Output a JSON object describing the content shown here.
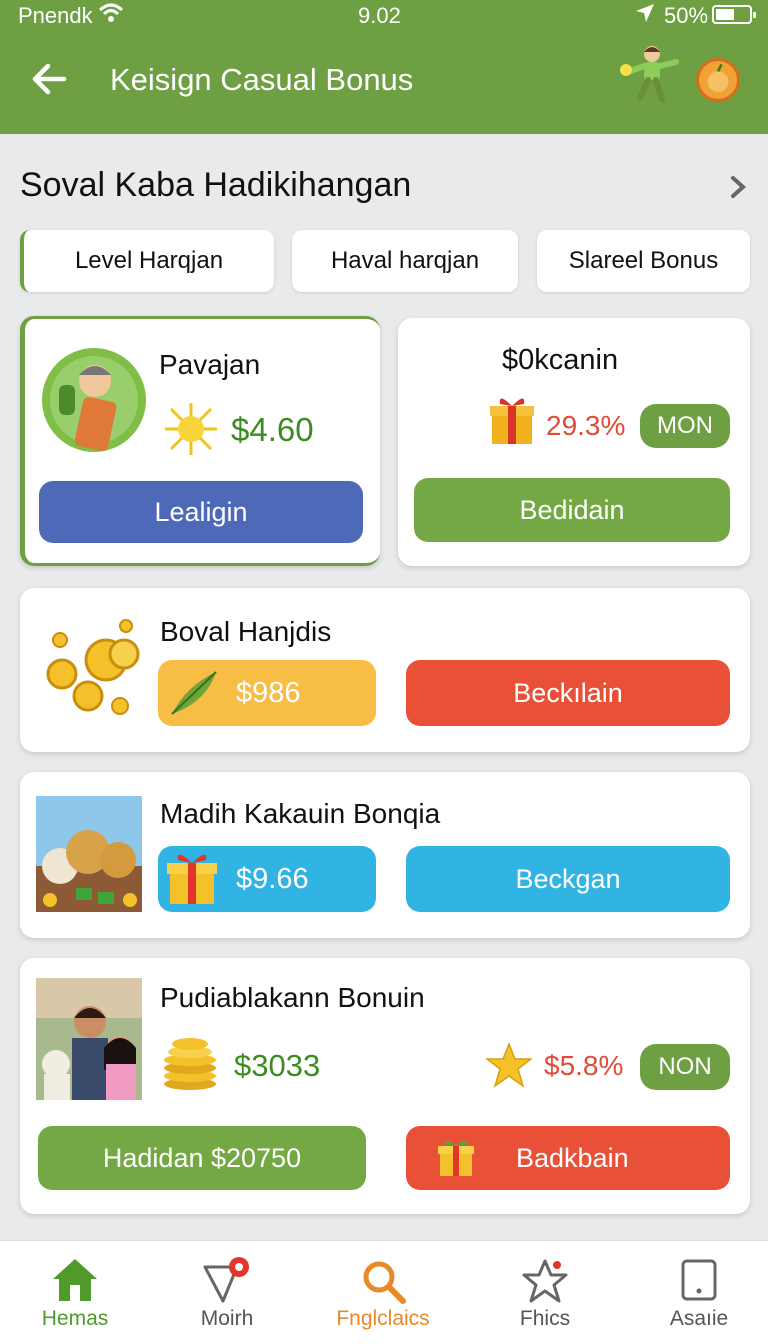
{
  "status": {
    "carrier": "Pnendk",
    "time": "9.02",
    "battery": "50%"
  },
  "header": {
    "title": "Keisign Casual Bonus"
  },
  "section": {
    "title": "Soval Kaba Hadikihangan"
  },
  "tabs": [
    "Level Harqjan",
    "Haval harqjan",
    "Slareel Bonus"
  ],
  "cards": {
    "card1": {
      "title": "Pavajan",
      "amount": "$4.60",
      "button": "Lealigin"
    },
    "card2": {
      "title": "$0kcanin",
      "amount": "29.3%",
      "pill": "MON",
      "button": "Bedidain"
    },
    "card3": {
      "title": "Boval Hanjdis",
      "amount": "$986",
      "button": "Beckılain"
    },
    "card4": {
      "title": "Madih Kakauin Bonqia",
      "amount": "$9.66",
      "button": "Beckgan"
    },
    "card5": {
      "title": "Pudiablakann Bonuin",
      "amount": "$3033",
      "amount2": "$5.8%",
      "pill": "NON",
      "button_left": "Hadidan $20750",
      "button_right": "Badkbain"
    }
  },
  "nav": [
    {
      "label": "Hemas",
      "icon": "home-icon",
      "color": "#4f9a2a"
    },
    {
      "label": "Moirh",
      "icon": "tag-icon",
      "color": "#555555"
    },
    {
      "label": "Fnglclaics",
      "icon": "search-icon",
      "color": "#e8892a"
    },
    {
      "label": "Fhics",
      "icon": "star-icon",
      "color": "#555555"
    },
    {
      "label": "Asaıie",
      "icon": "tablet-icon",
      "color": "#555555"
    }
  ],
  "colors": {
    "header": "#6f9f43",
    "blue": "#4d69b8",
    "green": "#74a844",
    "orange": "#f7bd45",
    "red": "#e85038",
    "cyan": "#31b4e4"
  }
}
